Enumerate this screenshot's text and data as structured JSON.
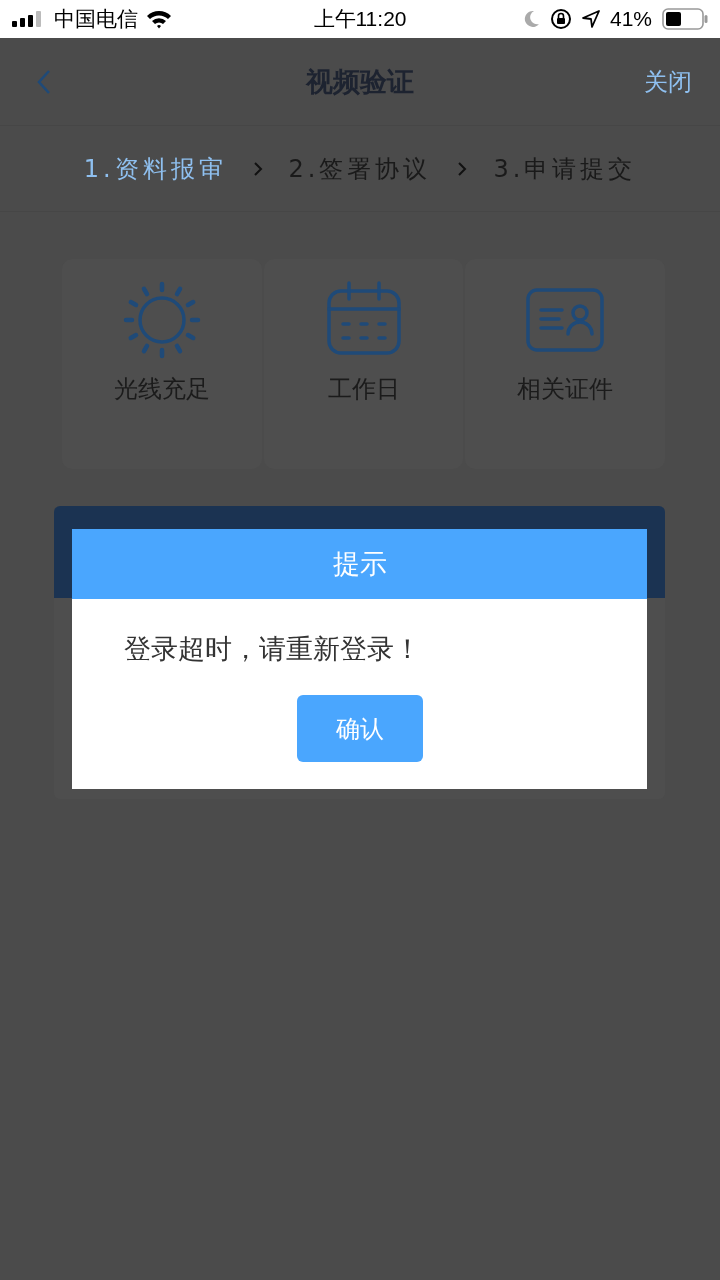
{
  "status_bar": {
    "carrier": "中国电信",
    "time": "上午11:20",
    "battery": "41%"
  },
  "header": {
    "title": "视频验证",
    "close": "关闭"
  },
  "steps": [
    {
      "label": "1.资料报审",
      "selected": true
    },
    {
      "label": "2.签署协议",
      "selected": false
    },
    {
      "label": "3.申请提交",
      "selected": false
    }
  ],
  "tips": [
    {
      "label": "光线充足",
      "kind": "sun"
    },
    {
      "label": "工作日",
      "kind": "calendar"
    },
    {
      "label": "相关证件",
      "kind": "id-card"
    }
  ],
  "dialog": {
    "title": "提示",
    "message": "登录超时，请重新登录！",
    "button": "确认"
  }
}
